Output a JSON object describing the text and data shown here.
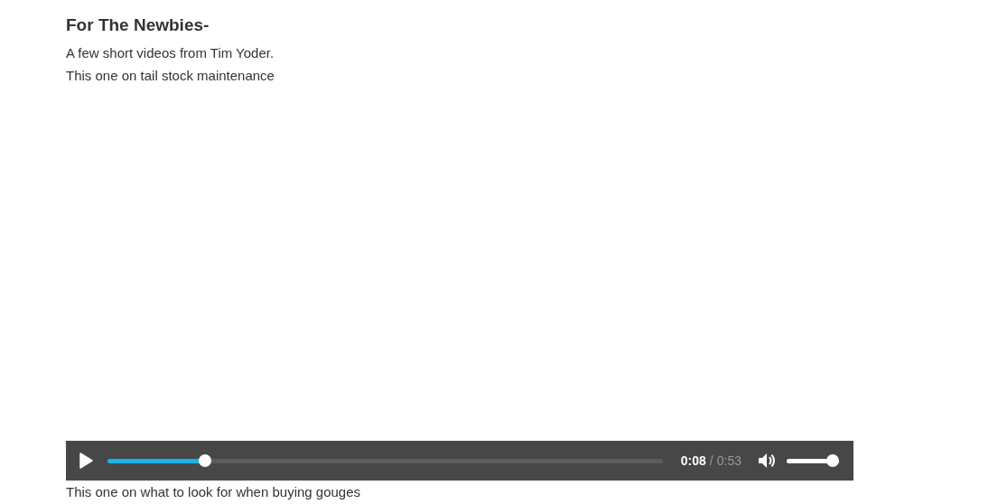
{
  "heading": "For The Newbies-",
  "intro": "A few short videos from Tim Yoder.",
  "video_caption": "This one on tail stock maintenance",
  "player": {
    "playing": false,
    "progress": {
      "level": 0.168
    },
    "current_time": "0:08",
    "separator": "/",
    "duration": "0:53",
    "muted": false,
    "volume": {
      "level": 1.0
    }
  },
  "next_caption": "This one on what to look for when buying gouges"
}
